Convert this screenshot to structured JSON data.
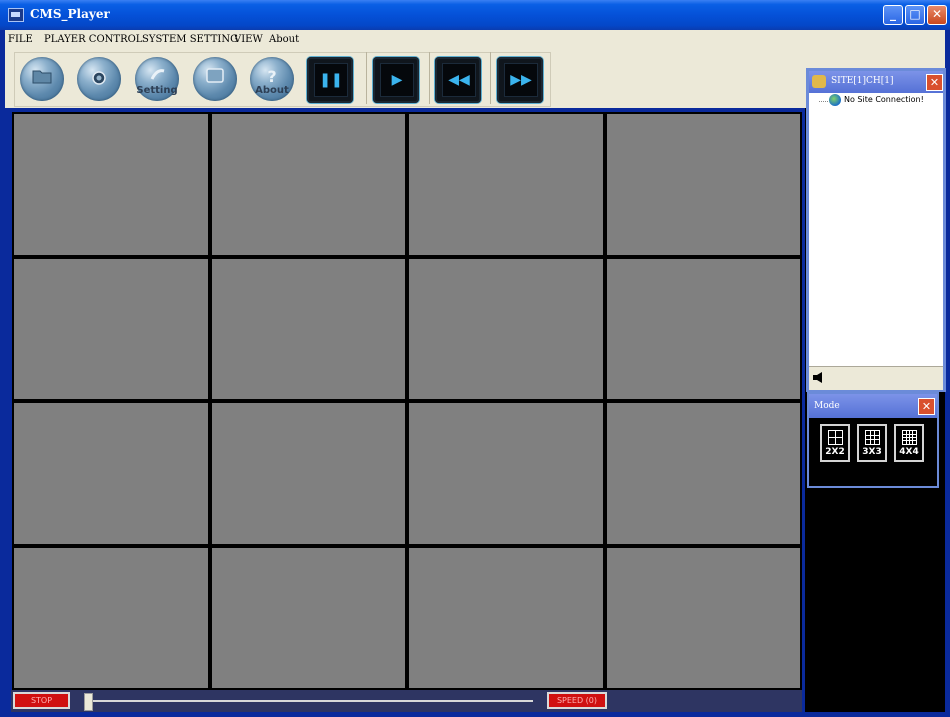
{
  "window": {
    "title": "CMS_Player"
  },
  "menu": [
    "FILE",
    "PLAYER CONTROL",
    "SYSTEM SETTING",
    "VIEW",
    "About"
  ],
  "toolbar": {
    "round_buttons": [
      {
        "icon": "folder-icon",
        "label": ""
      },
      {
        "icon": "camera-icon",
        "label": ""
      },
      {
        "icon": "setting-icon",
        "label": "Setting"
      },
      {
        "icon": "monitor-icon",
        "label": ""
      },
      {
        "icon": "about-icon",
        "label": "About"
      }
    ],
    "media_buttons": [
      {
        "icon": "pause-icon",
        "symbol": "❚❚"
      },
      {
        "icon": "play-icon",
        "symbol": "▶"
      },
      {
        "icon": "rewind-icon",
        "symbol": "◀◀"
      },
      {
        "icon": "fast-forward-icon",
        "symbol": "▶▶"
      }
    ]
  },
  "video_grid": {
    "rows": 4,
    "cols": 4
  },
  "playback": {
    "stop_label": "STOP",
    "speed_label": "SPEED (0)",
    "position": 0
  },
  "site_panel": {
    "title": "SITE[1]CH[1]",
    "status": "No Site Connection!"
  },
  "mode_panel": {
    "title": "Mode",
    "modes": [
      "2X2",
      "3X3",
      "4X4"
    ]
  }
}
